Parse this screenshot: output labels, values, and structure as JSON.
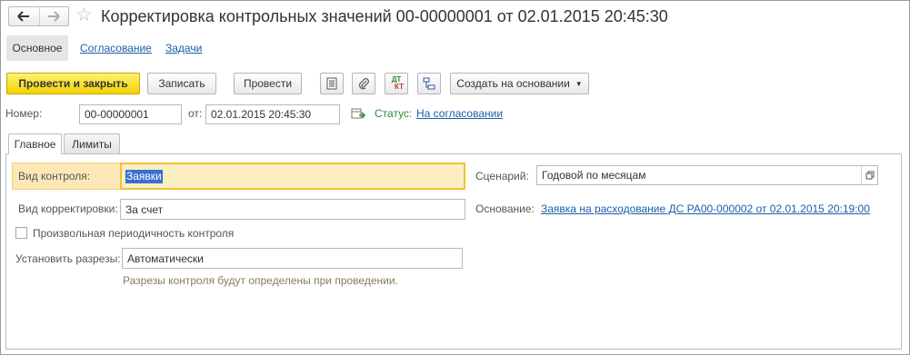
{
  "window": {
    "title": "Корректировка контрольных значений 00-00000001 от 02.01.2015 20:45:30"
  },
  "sections": {
    "main": "Основное",
    "approval": "Согласование",
    "tasks": "Задачи"
  },
  "toolbar": {
    "post_close": "Провести и закрыть",
    "save": "Записать",
    "post": "Провести",
    "dt_label": "ДТ",
    "kt_label": "КТ",
    "create_based": "Создать на основании"
  },
  "header": {
    "number_label": "Номер:",
    "number_value": "00-00000001",
    "date_label": "от:",
    "date_value": "02.01.2015 20:45:30",
    "status_label": "Статус:",
    "status_value": "На согласовании"
  },
  "tabs": [
    "Главное",
    "Лимиты"
  ],
  "form": {
    "control_type_label": "Вид контроля:",
    "control_type_value": "Заявки",
    "scenario_label": "Сценарий:",
    "scenario_value": "Годовой по месяцам",
    "correction_type_label": "Вид корректировки:",
    "correction_type_value": "За счет",
    "basis_label": "Основание:",
    "basis_value": "Заявка на расходование ДС РА00-000002 от 02.01.2015 20:19:00",
    "arbitrary_period_label": "Произвольная периодичность контроля",
    "arbitrary_period_checked": false,
    "set_sections_label": "Установить разрезы:",
    "set_sections_value": "Автоматически",
    "hint": "Разрезы контроля будут определены при проведении."
  },
  "colors": {
    "primary_button": "#f3d200",
    "link": "#1b5fa8",
    "status": "#2e8b3b",
    "highlight": "#fbe8b6"
  }
}
